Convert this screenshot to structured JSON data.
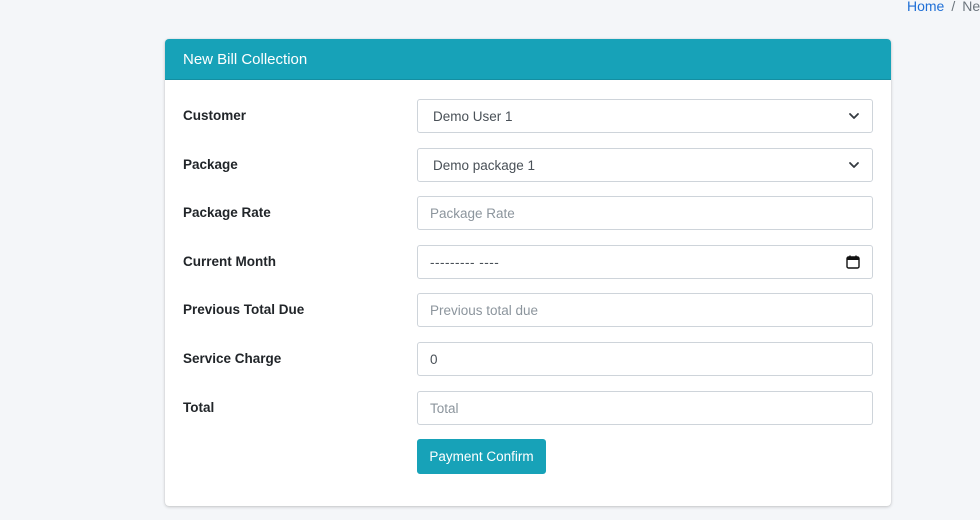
{
  "breadcrumb": {
    "home": "Home",
    "separator": "/",
    "current": "Ne"
  },
  "card": {
    "title": "New Bill Collection",
    "header_color": "#17a2b8"
  },
  "form": {
    "customer": {
      "label": "Customer",
      "selected": "Demo User 1"
    },
    "package": {
      "label": "Package",
      "selected": "Demo package 1"
    },
    "package_rate": {
      "label": "Package Rate",
      "placeholder": "Package Rate",
      "value": ""
    },
    "current_month": {
      "label": "Current Month",
      "display": "--------- ----"
    },
    "previous_total_due": {
      "label": "Previous Total Due",
      "placeholder": "Previous total due",
      "value": ""
    },
    "service_charge": {
      "label": "Service Charge",
      "value": "0"
    },
    "total": {
      "label": "Total",
      "placeholder": "Total",
      "value": ""
    },
    "submit_label": "Payment Confirm"
  },
  "icons": {
    "select_arrow": "chevron-down-icon",
    "date_picker": "calendar-icon"
  }
}
